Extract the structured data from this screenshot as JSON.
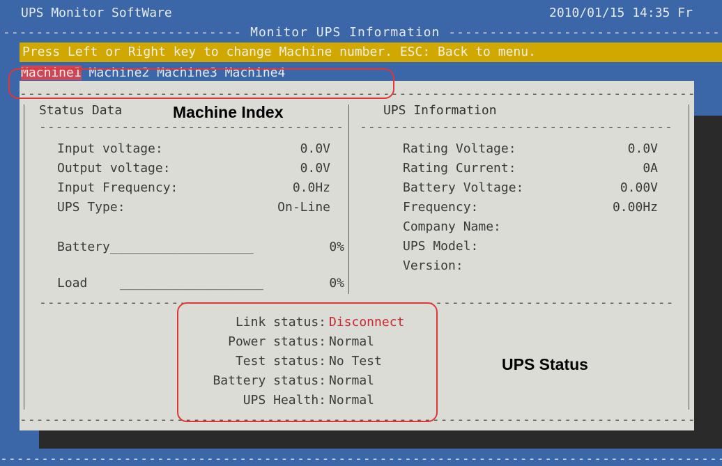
{
  "window": {
    "title": "UPS Monitor SoftWare",
    "datetime": "2010/01/15 14:35 Fr"
  },
  "header": {
    "title": "Monitor UPS Information",
    "dashes_left": "----------------------------- ",
    "dashes_right": " -----------------------------------"
  },
  "hint": "Press Left or Right key to change Machine number. ESC: Back to menu.",
  "machines": [
    "Machine1",
    "Machine2",
    "Machine3",
    "Machine4"
  ],
  "status_data": {
    "title": "Status Data",
    "rows": [
      {
        "label": "Input voltage:",
        "value": "0.0V"
      },
      {
        "label": "Output voltage:",
        "value": "0.0V"
      },
      {
        "label": "Input Frequency:",
        "value": "0.0Hz"
      },
      {
        "label": "UPS Type:",
        "value": "On-Line"
      }
    ],
    "battery": {
      "label": "Battery",
      "fill": "___________________",
      "value": "0%"
    },
    "load": {
      "label": "Load",
      "fill": "___________________",
      "value": "0%"
    }
  },
  "ups_info": {
    "title": "UPS Information",
    "rows": [
      {
        "label": "Rating Voltage:",
        "value": "0.0V"
      },
      {
        "label": "Rating Current:",
        "value": "0A"
      },
      {
        "label": "Battery Voltage:",
        "value": "0.00V"
      },
      {
        "label": "Frequency:",
        "value": "0.00Hz"
      },
      {
        "label": "Company Name:",
        "value": ""
      },
      {
        "label": "UPS Model:",
        "value": ""
      },
      {
        "label": "Version:",
        "value": ""
      }
    ]
  },
  "ups_status": {
    "rows": [
      {
        "label": "Link status:",
        "value": "Disconnect",
        "alert": true
      },
      {
        "label": "Power status:",
        "value": "Normal",
        "alert": false
      },
      {
        "label": "Test status:",
        "value": "No Test",
        "alert": false
      },
      {
        "label": "Battery status:",
        "value": "Normal",
        "alert": false
      },
      {
        "label": "UPS Health:",
        "value": "Normal",
        "alert": false
      }
    ]
  },
  "annotations": {
    "machine_index": "Machine Index",
    "ups_status": "UPS Status"
  },
  "colors": {
    "background": "#3b66a8",
    "hint_bar": "#d1a800",
    "panel": "#dcdcd6",
    "alert": "#c8282e",
    "annotation": "#e23535"
  }
}
